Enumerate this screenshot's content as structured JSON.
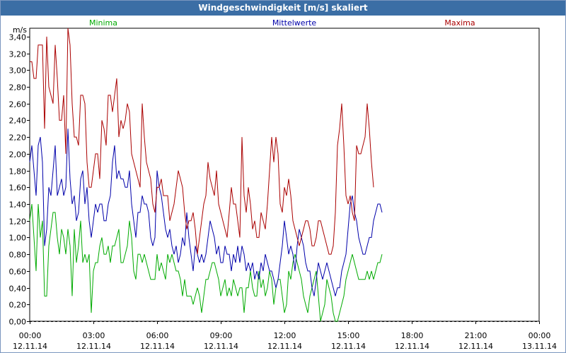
{
  "window": {
    "title": "Windgeschwindigkeit [m/s] skaliert"
  },
  "colors": {
    "minima": "#00aa00",
    "mittel": "#0000aa",
    "maxima": "#aa0000",
    "grid": "#000000",
    "titlebar": "#3b6ea5"
  },
  "chart_data": {
    "type": "line",
    "title": "Windgeschwindigkeit [m/s] skaliert",
    "ylabel": "m/s",
    "ylim": [
      0,
      3.5
    ],
    "yticks": [
      "0,00",
      "0,20",
      "0,40",
      "0,60",
      "0,80",
      "1,00",
      "1,20",
      "1,40",
      "1,60",
      "1,80",
      "2,00",
      "2,20",
      "2,40",
      "2,60",
      "2,80",
      "3,00",
      "3,20",
      "3,40"
    ],
    "xlim_hours": [
      0,
      24
    ],
    "xticks": [
      {
        "time": "00:00",
        "date": "12.11.14"
      },
      {
        "time": "03:00",
        "date": "12.11.14"
      },
      {
        "time": "06:00",
        "date": "12.11.14"
      },
      {
        "time": "09:00",
        "date": "12.11.14"
      },
      {
        "time": "12:00",
        "date": "12.11.14"
      },
      {
        "time": "15:00",
        "date": "12.11.14"
      },
      {
        "time": "18:00",
        "date": "12.11.14"
      },
      {
        "time": "21:00",
        "date": "12.11.14"
      },
      {
        "time": "00:00",
        "date": "13.11.14"
      }
    ],
    "grid": true,
    "legend_position": "top",
    "x_step_hours": 0.1,
    "series": [
      {
        "name": "Minima",
        "color": "#00aa00",
        "values": [
          1.2,
          1.4,
          1.0,
          0.6,
          1.4,
          1.0,
          1.2,
          0.3,
          0.3,
          0.9,
          1.1,
          1.3,
          1.3,
          1.0,
          0.8,
          1.1,
          1.0,
          0.8,
          1.1,
          0.9,
          0.3,
          1.1,
          0.7,
          0.9,
          1.2,
          0.7,
          0.8,
          0.7,
          0.8,
          0.1,
          0.6,
          0.7,
          0.7,
          0.9,
          1.0,
          0.8,
          0.8,
          0.9,
          0.7,
          0.9,
          0.9,
          1.0,
          1.1,
          0.7,
          0.7,
          0.8,
          0.9,
          1.2,
          1.0,
          0.6,
          0.5,
          0.8,
          0.8,
          0.7,
          0.8,
          0.7,
          0.6,
          0.5,
          0.5,
          0.5,
          0.8,
          0.6,
          0.7,
          0.6,
          0.5,
          0.8,
          0.7,
          0.8,
          0.7,
          0.6,
          0.6,
          0.5,
          0.3,
          0.5,
          0.3,
          0.3,
          0.3,
          0.2,
          0.3,
          0.4,
          0.3,
          0.1,
          0.3,
          0.5,
          0.5,
          0.6,
          0.7,
          0.7,
          0.6,
          0.5,
          0.3,
          0.4,
          0.5,
          0.3,
          0.4,
          0.3,
          0.5,
          0.4,
          0.3,
          0.4,
          0.4,
          0.1,
          0.4,
          0.4,
          0.6,
          0.4,
          0.3,
          0.3,
          0.6,
          0.4,
          0.5,
          0.3,
          0.4,
          0.6,
          0.5,
          0.2,
          0.4,
          0.5,
          0.5,
          0.3,
          0.1,
          0.2,
          0.6,
          0.5,
          0.7,
          0.8,
          0.7,
          0.6,
          0.5,
          0.3,
          0.2,
          0.1,
          0.3,
          0.4,
          0.5,
          0.6,
          0.3,
          0.0,
          0.1,
          0.2,
          0.5,
          0.4,
          0.3,
          0.1,
          0.0,
          0.0,
          0.1,
          0.2,
          0.3,
          0.5,
          0.6,
          0.7,
          0.8,
          0.7,
          0.6,
          0.5,
          0.5,
          0.5,
          0.5,
          0.6,
          0.5,
          0.6,
          0.5,
          0.6,
          0.7,
          0.7,
          0.8
        ]
      },
      {
        "name": "Mittelwerte",
        "color": "#0000aa",
        "values": [
          1.9,
          2.1,
          1.8,
          1.5,
          2.1,
          2.2,
          1.9,
          0.9,
          1.1,
          1.6,
          1.5,
          1.8,
          2.1,
          1.5,
          1.6,
          1.7,
          1.5,
          1.6,
          2.3,
          1.7,
          1.4,
          1.5,
          1.2,
          1.3,
          1.7,
          1.8,
          1.4,
          1.6,
          1.2,
          1.0,
          1.2,
          1.4,
          1.3,
          1.4,
          1.4,
          1.2,
          1.2,
          1.4,
          1.5,
          1.9,
          2.1,
          1.7,
          1.8,
          1.7,
          1.7,
          1.6,
          1.6,
          1.8,
          1.4,
          1.2,
          1.0,
          1.3,
          1.3,
          1.5,
          1.4,
          1.4,
          1.3,
          1.0,
          0.9,
          1.0,
          1.8,
          1.6,
          1.5,
          1.3,
          1.1,
          1.0,
          1.1,
          0.9,
          0.8,
          0.9,
          0.7,
          0.8,
          1.0,
          0.9,
          1.3,
          1.0,
          0.8,
          0.6,
          0.9,
          0.8,
          0.7,
          0.8,
          0.7,
          0.8,
          1.0,
          1.2,
          1.1,
          1.0,
          0.8,
          0.9,
          0.7,
          0.7,
          0.9,
          0.8,
          0.8,
          0.6,
          0.8,
          0.7,
          0.9,
          0.7,
          0.9,
          0.8,
          0.6,
          0.7,
          0.6,
          0.7,
          0.5,
          0.6,
          0.5,
          0.7,
          0.6,
          0.8,
          0.7,
          0.6,
          0.6,
          0.5,
          0.4,
          0.5,
          0.7,
          0.9,
          1.2,
          1.0,
          0.8,
          0.9,
          0.8,
          0.6,
          0.9,
          1.1,
          1.0,
          0.9,
          0.7,
          0.6,
          0.6,
          0.4,
          0.3,
          0.5,
          0.7,
          0.6,
          0.5,
          0.6,
          0.7,
          0.6,
          0.5,
          0.4,
          0.3,
          0.4,
          0.4,
          0.6,
          0.7,
          0.8,
          1.1,
          1.4,
          1.5,
          1.3,
          1.2,
          1.0,
          0.9,
          0.8,
          0.8,
          0.9,
          1.0,
          1.0,
          1.2,
          1.3,
          1.4,
          1.4,
          1.3
        ]
      },
      {
        "name": "Maxima",
        "color": "#aa0000",
        "values": [
          3.1,
          3.1,
          2.9,
          2.9,
          3.3,
          3.3,
          3.3,
          2.3,
          3.4,
          2.8,
          2.7,
          2.6,
          3.3,
          2.9,
          2.4,
          2.4,
          2.7,
          2.0,
          3.5,
          3.3,
          2.6,
          2.2,
          2.2,
          2.1,
          2.7,
          2.7,
          2.6,
          1.9,
          1.6,
          1.6,
          1.8,
          2.0,
          2.0,
          1.7,
          2.4,
          2.3,
          2.1,
          2.7,
          2.7,
          2.5,
          2.7,
          2.9,
          2.2,
          2.4,
          2.3,
          2.4,
          2.6,
          2.5,
          2.0,
          1.9,
          1.8,
          1.7,
          1.6,
          2.6,
          2.2,
          1.9,
          1.8,
          1.7,
          1.4,
          1.3,
          1.6,
          1.6,
          1.7,
          1.5,
          1.5,
          1.5,
          1.2,
          1.3,
          1.4,
          1.6,
          1.8,
          1.7,
          1.6,
          1.3,
          1.1,
          1.2,
          1.2,
          1.3,
          1.1,
          0.8,
          1.0,
          1.2,
          1.4,
          1.5,
          1.9,
          1.7,
          1.6,
          1.5,
          1.8,
          1.4,
          1.3,
          1.2,
          1.1,
          1.0,
          1.3,
          1.6,
          1.4,
          1.4,
          1.2,
          1.0,
          2.2,
          1.5,
          1.3,
          1.6,
          1.4,
          1.1,
          1.2,
          1.0,
          1.0,
          1.3,
          1.2,
          1.1,
          1.4,
          1.8,
          2.2,
          1.9,
          2.2,
          2.0,
          1.4,
          1.3,
          1.6,
          1.5,
          1.7,
          1.5,
          1.2,
          1.1,
          1.0,
          0.9,
          1.0,
          1.1,
          1.2,
          1.2,
          1.1,
          0.9,
          0.9,
          1.0,
          1.2,
          1.2,
          1.1,
          1.0,
          0.9,
          0.8,
          0.8,
          0.9,
          1.3,
          2.1,
          2.3,
          2.6,
          2.1,
          1.5,
          1.4,
          1.5,
          1.3,
          1.2,
          2.1,
          2.0,
          2.0,
          2.1,
          2.2,
          2.6,
          2.3,
          1.9,
          1.6
        ]
      }
    ]
  }
}
